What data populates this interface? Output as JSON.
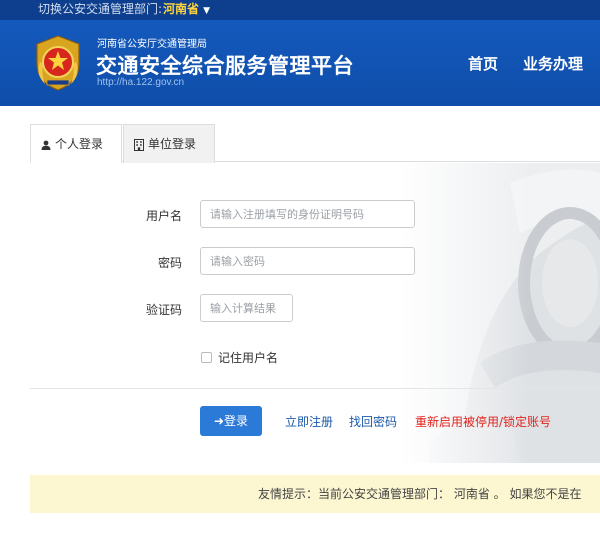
{
  "topbar": {
    "switch_label": "切换公安交通管理部门:",
    "province": "河南省"
  },
  "header": {
    "org": "河南省公安厅交通管理局",
    "title": "交通安全综合服务管理平台",
    "url": "http://ha.122.gov.cn",
    "nav": [
      "首页",
      "业务办理"
    ]
  },
  "tabs": {
    "personal": "个人登录",
    "unit": "单位登录"
  },
  "form": {
    "username_label": "用户名",
    "username_placeholder": "请输入注册填写的身份证明号码",
    "password_label": "密码",
    "password_placeholder": "请输入密码",
    "captcha_label": "验证码",
    "captcha_placeholder": "输入计算结果",
    "remember_label": "记住用户名"
  },
  "actions": {
    "login": "登录",
    "register": "立即注册",
    "forgot": "找回密码",
    "reactivate": "重新启用被停用/锁定账号"
  },
  "tip": {
    "text": "友情提示：当前公安交通管理部门： 河南省 。 如果您不是在"
  },
  "colors": {
    "header_blue": "#1459bd",
    "topbar_blue": "#0d3f8e",
    "province_yellow": "#ffd33d",
    "login_button": "#2c7ad8",
    "link_blue": "#1a5aa8",
    "link_red": "#e0231e",
    "tip_background": "#fcf6d1"
  },
  "icons": {
    "emblem": "police-emblem-icon",
    "personal_tab": "user-icon",
    "unit_tab": "building-icon",
    "login": "sign-in-icon"
  }
}
